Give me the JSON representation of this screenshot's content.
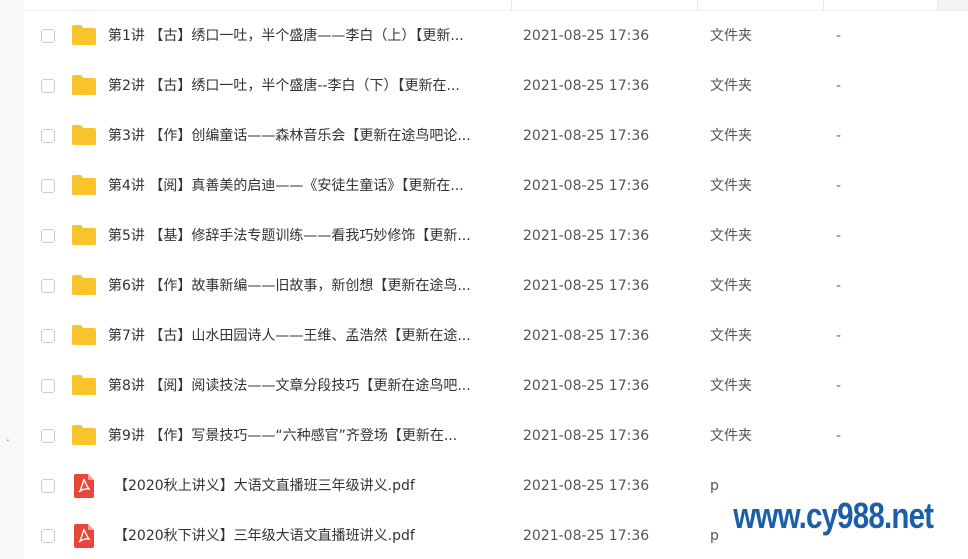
{
  "rows": [
    {
      "type": "folder",
      "name": "第1讲 【古】绣口一吐，半个盛唐——李白（上）【更新...",
      "date": "2021-08-25 17:36",
      "kind": "文件夹",
      "size": "-"
    },
    {
      "type": "folder",
      "name": "第2讲 【古】绣口一吐，半个盛唐--李白（下）【更新在...",
      "date": "2021-08-25 17:36",
      "kind": "文件夹",
      "size": "-"
    },
    {
      "type": "folder",
      "name": "第3讲 【作】创编童话——森林音乐会【更新在途鸟吧论...",
      "date": "2021-08-25 17:36",
      "kind": "文件夹",
      "size": "-"
    },
    {
      "type": "folder",
      "name": "第4讲 【阅】真善美的启迪——《安徒生童话》【更新在...",
      "date": "2021-08-25 17:36",
      "kind": "文件夹",
      "size": "-"
    },
    {
      "type": "folder",
      "name": "第5讲 【基】修辞手法专题训练——看我巧妙修饰【更新...",
      "date": "2021-08-25 17:36",
      "kind": "文件夹",
      "size": "-"
    },
    {
      "type": "folder",
      "name": "第6讲 【作】故事新编——旧故事，新创想【更新在途鸟...",
      "date": "2021-08-25 17:36",
      "kind": "文件夹",
      "size": "-"
    },
    {
      "type": "folder",
      "name": "第7讲 【古】山水田园诗人——王维、孟浩然【更新在途...",
      "date": "2021-08-25 17:36",
      "kind": "文件夹",
      "size": "-"
    },
    {
      "type": "folder",
      "name": "第8讲 【阅】阅读技法——文章分段技巧【更新在途鸟吧...",
      "date": "2021-08-25 17:36",
      "kind": "文件夹",
      "size": "-"
    },
    {
      "type": "folder",
      "name": "第9讲 【作】写景技巧——“六种感官”齐登场【更新在...",
      "date": "2021-08-25 17:36",
      "kind": "文件夹",
      "size": "-"
    },
    {
      "type": "pdf",
      "name": "【2020秋上讲义】大语文直播班三年级讲义.pdf",
      "date": "2021-08-25 17:36",
      "kind": "p",
      "size": ""
    },
    {
      "type": "pdf",
      "name": "【2020秋下讲义】三年级大语文直播班讲义.pdf",
      "date": "2021-08-25 17:36",
      "kind": "p",
      "size": ""
    }
  ],
  "watermark": "www.cy988.net",
  "colors": {
    "folder": "#f8c42b",
    "pdf": "#e8453c",
    "watermark": "#1c5ea8"
  }
}
